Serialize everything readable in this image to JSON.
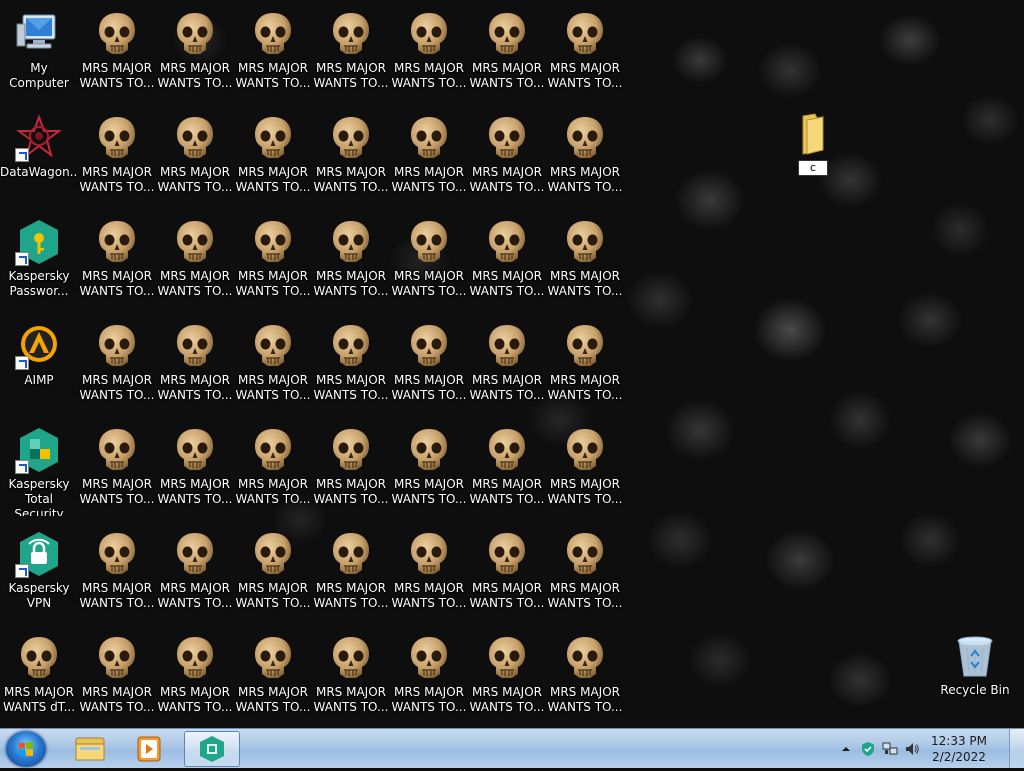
{
  "desktop": {
    "left_icons": [
      {
        "label": "My Computer",
        "icon": "computer-icon"
      },
      {
        "label": "DataWagon...",
        "icon": "datawagon-icon"
      },
      {
        "label": "Kaspersky Passwor...",
        "icon": "kaspersky-password-icon"
      },
      {
        "label": "AIMP",
        "icon": "aimp-icon"
      },
      {
        "label": "Kaspersky Total Security",
        "icon": "kaspersky-total-icon"
      },
      {
        "label": "Kaspersky VPN",
        "icon": "kaspersky-vpn-icon"
      },
      {
        "label": "MRS MAJOR WANTS dT...",
        "icon": "skull-icon"
      }
    ],
    "skull_label": "MRS MAJOR WANTS TO...",
    "skull_rows": 7,
    "skull_cols": 7,
    "folder": {
      "label": "c",
      "icon": "folder-icon"
    },
    "recycle_bin": {
      "label": "Recycle Bin",
      "icon": "recycle-bin-icon"
    }
  },
  "taskbar": {
    "start": {
      "icon": "windows-logo-icon"
    },
    "pinned": [
      {
        "name": "explorer",
        "icon": "folder-icon",
        "active": false
      },
      {
        "name": "media-player",
        "icon": "media-player-icon",
        "active": false
      },
      {
        "name": "kaspersky",
        "icon": "kaspersky-icon",
        "active": true
      }
    ],
    "tray": {
      "time": "12:33 PM",
      "date": "2/2/2022",
      "icons": [
        "chevron-up-icon",
        "shield-icon",
        "network-icon",
        "volume-icon"
      ]
    }
  },
  "colors": {
    "kaspersky_green": "#1fa58a",
    "aimp_orange": "#f5a300",
    "skull_bone": "#c7a06a"
  }
}
